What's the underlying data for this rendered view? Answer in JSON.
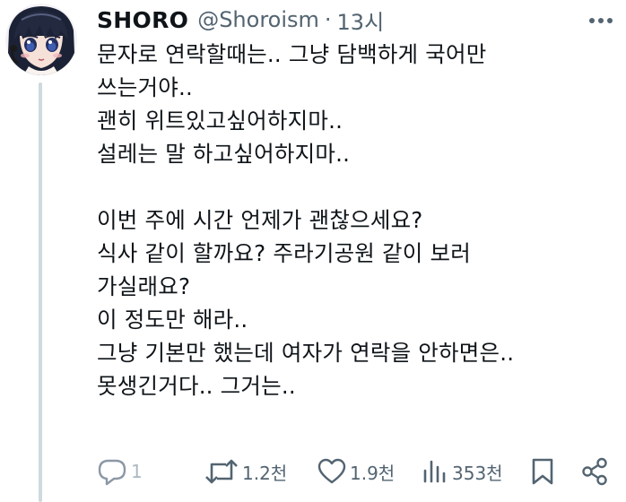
{
  "tweet": {
    "display_name": "SHORO",
    "handle": "@Shoroism",
    "separator": "·",
    "time": "13시",
    "text": "문자로 연락할때는.. 그냥 담백하게 국어만\n쓰는거야..\n괜히 위트있고싶어하지마..\n설레는 말 하고싶어하지마..\n\n이번 주에 시간 언제가 괜찮으세요?\n식사 같이 할까요? 주라기공원 같이 보러\n가실래요?\n이 정도만 해라..\n그냥 기본만 했는데 여자가 연락을 안하면은..\n못생긴거다.. 그거는..",
    "avatar_icon": "anime-avatar"
  },
  "actions": {
    "reply": {
      "icon": "reply-icon",
      "count": "1"
    },
    "retweet": {
      "icon": "retweet-icon",
      "count": "1.2천"
    },
    "like": {
      "icon": "heart-icon",
      "count": "1.9천"
    },
    "views": {
      "icon": "views-icon",
      "count": "353천"
    },
    "bookmark": {
      "icon": "bookmark-icon"
    },
    "share": {
      "icon": "share-icon"
    }
  },
  "colors": {
    "text": "#0f1419",
    "secondary": "#536471",
    "thread_line": "#cfd9de"
  }
}
